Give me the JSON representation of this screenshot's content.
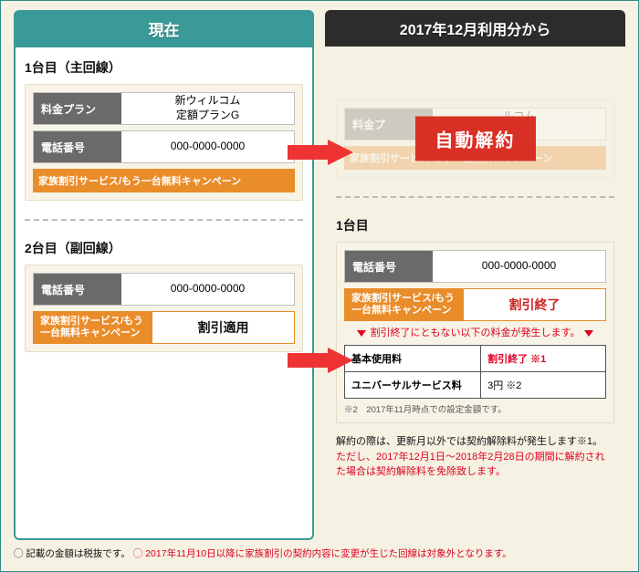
{
  "left": {
    "header": "現在",
    "device1": {
      "title": "1台目（主回線）",
      "plan_label": "料金プラン",
      "plan_value": "新ウィルコム\n定額プランG",
      "phone_label": "電話番号",
      "phone_value": "000-0000-0000",
      "campaign": "家族割引サービス/もう一台無料キャンペーン"
    },
    "device2": {
      "title": "2台目（副回線）",
      "phone_label": "電話番号",
      "phone_value": "000-0000-0000",
      "campaign_label": "家族割引サービス/もう一台無料キャンペーン",
      "campaign_value": "割引適用"
    }
  },
  "right": {
    "header": "2017年12月利用分から",
    "faded_device1": {
      "plan_label": "料金プ",
      "plan_value": "ルコム\nランG",
      "campaign": "家族割引サービス/もう一台無料キャンペーン",
      "stamp": "自動解約"
    },
    "device1": {
      "title": "1台目",
      "phone_label": "電話番号",
      "phone_value": "000-0000-0000",
      "campaign_label": "家族割引サービス/もう一台無料キャンペーン",
      "campaign_value": "割引終了",
      "red_note": "割引終了にともない以下の料金が発生します。",
      "fees": [
        {
          "label": "基本使用料",
          "value": "割引終了 ※1",
          "red": true
        },
        {
          "label": "ユニバーサルサービス料",
          "value": "3円 ※2",
          "red": false
        }
      ],
      "fee_footnote": "※2　2017年11月時点での設定金額です。",
      "explain_black": "解約の際は、更新月以外では契約解除料が発生します※1。",
      "explain_red": "ただし、2017年12月1日〜2018年2月28日の期間に解約された場合は契約解除料を免除致します。"
    }
  },
  "footnote": {
    "black": "◯ 記載の金額は税抜です。",
    "red": "◯ 2017年11月10日以降に家族割引の契約内容に変更が生じた回線は対象外となります。"
  }
}
